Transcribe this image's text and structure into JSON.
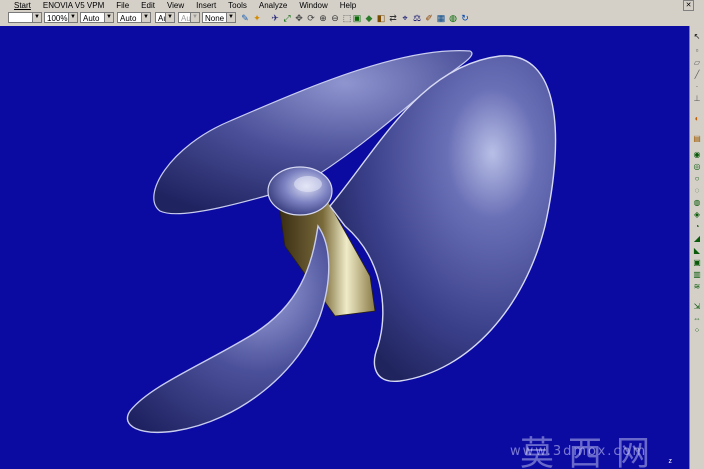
{
  "menubar": {
    "items": [
      "Start",
      "ENOVIA V5 VPM",
      "File",
      "Edit",
      "View",
      "Insert",
      "Tools",
      "Analyze",
      "Window",
      "Help"
    ]
  },
  "toolbar": {
    "combos": [
      {
        "value": "",
        "disabled": false
      },
      {
        "value": "100%",
        "disabled": false
      },
      {
        "value": "Auto",
        "disabled": false
      },
      {
        "value": "Auto",
        "disabled": false
      },
      {
        "value": "Aut",
        "disabled": false
      },
      {
        "value": "Aut",
        "disabled": true
      },
      {
        "value": "None",
        "disabled": false
      }
    ]
  },
  "watermark": {
    "chars": "莫西网",
    "url": "www.3dmox.com"
  },
  "compass": {
    "label": "z"
  },
  "colors": {
    "background": "#0b0ba2",
    "blade": "#3a3f8a",
    "hub": "#7a6a3a"
  }
}
